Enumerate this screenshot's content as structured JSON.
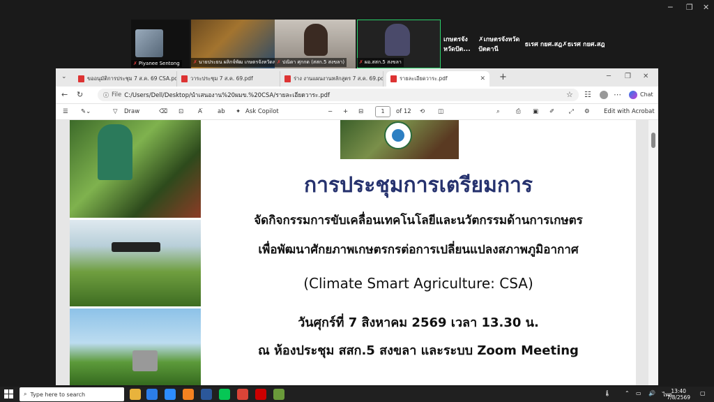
{
  "zoom": {
    "participants": [
      {
        "name": "Piyanee Sentong"
      },
      {
        "name": "นายประยน ผลิกจ์พัฒ เกษตรจังหวัดสงขลา"
      },
      {
        "name": "ปณิดา ศุกกด (สสก.5 สงขลา)"
      },
      {
        "name": "ผอ.สสก.5 สงขลา"
      },
      {
        "name": "เกษตรจังหวัดปัต..."
      },
      {
        "name": "ธเรศ กยศ.สฎ"
      }
    ],
    "subnames": [
      "เกษตรจังหวัดปัตตานี",
      "ธเรศ กยศ.สฎ"
    ]
  },
  "browser": {
    "tabs": [
      {
        "label": "ขออนุมัติการประชุม 7 ส.ค. 69 CSA.pdf"
      },
      {
        "label": "วาระประชุม 7 ส.ค. 69.pdf"
      },
      {
        "label": "ร่าง งานแผนงานหลักสูตร 7 ส.ค. 69.pdf"
      },
      {
        "label": "รายละเอียดวาระ.pdf"
      }
    ],
    "url_prefix": "File",
    "url": "C:/Users/Dell/Desktop/นำเสนองาน%20ผมข.%20CSA/รายละเอียดวาระ.pdf",
    "chat_label": "Chat"
  },
  "pdf_toolbar": {
    "draw_label": "Draw",
    "ask_copilot": "Ask Copilot",
    "page_current": "1",
    "page_total": "of 12",
    "edit_acrobat": "Edit with Acrobat"
  },
  "document": {
    "title": "การประชุมการเตรียมการ",
    "line2": "จัดกิจกรรมการขับเคลื่อนเทคโนโลยีและนวัตกรรมด้านการเกษตร",
    "line3": "เพื่อพัฒนาศักยภาพเกษตรกรต่อการเปลี่ยนแปลงสภาพภูมิอากาศ",
    "line4": "(Climate Smart Agriculture: CSA)",
    "line5": "วันศุกร์ที่ 7 สิงหาคม 2569 เวลา 13.30 น.",
    "line6": "ณ ห้องประชุม สสก.5 สงขลา และระบบ Zoom Meeting"
  },
  "taskbar": {
    "search_placeholder": "Type here to search",
    "time": "13:40",
    "date": "7/8/2569",
    "lang": "ไทย"
  }
}
